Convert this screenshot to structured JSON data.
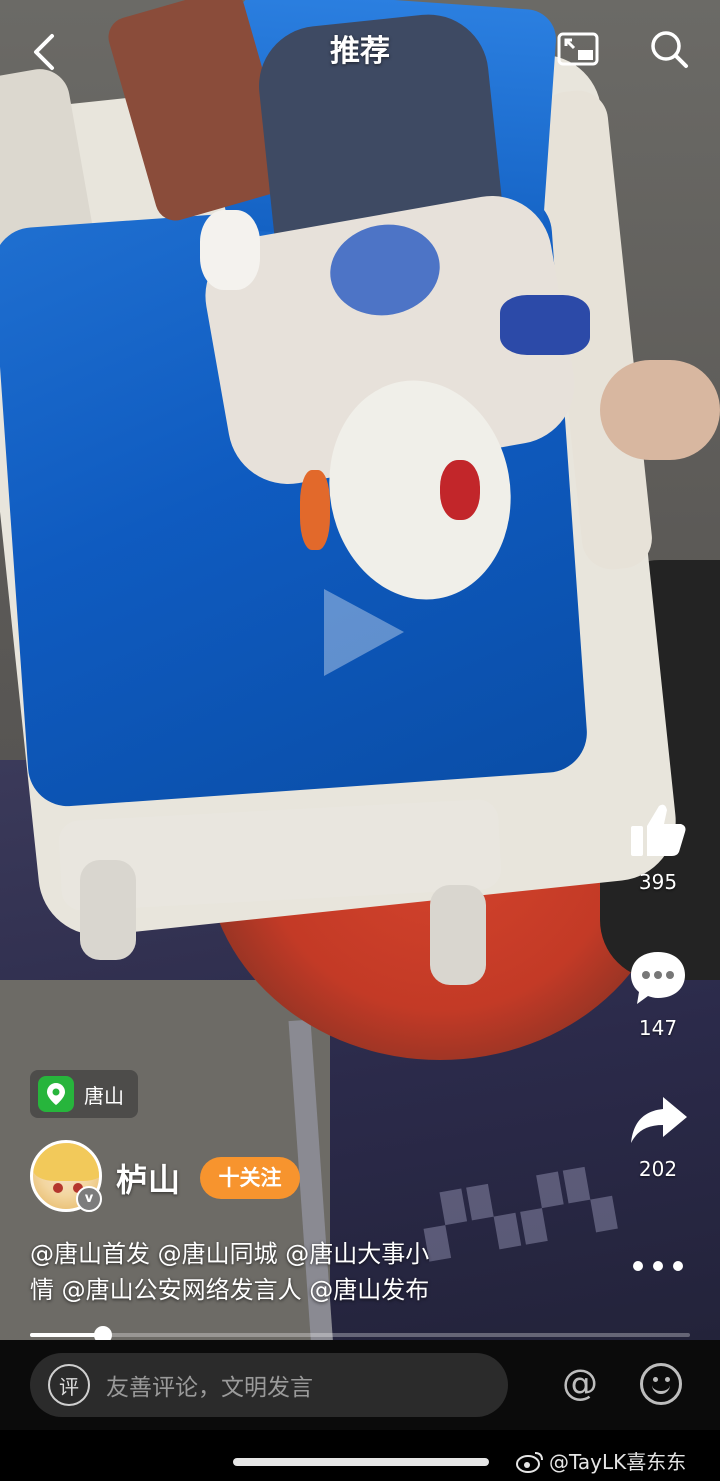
{
  "header": {
    "title": "推荐"
  },
  "actions": {
    "like_count": "395",
    "comment_count": "147",
    "share_count": "202"
  },
  "location": {
    "label": "唐山"
  },
  "author": {
    "name": "栌山",
    "follow_label": "十关注",
    "verified_badge": "v"
  },
  "caption": {
    "line1": "@唐山首发 @唐山同城 @唐山大事小",
    "line2": "情 @唐山公安网络发言人 @唐山发布"
  },
  "progress": {
    "fraction": 0.11
  },
  "comment_bar": {
    "ping_glyph": "评",
    "placeholder": "友善评论，文明发言",
    "at_glyph": "@"
  },
  "watermark": {
    "text": "@TayLK喜东东"
  },
  "colors": {
    "follow_button": "#f7942e",
    "location_pin": "#27b53c"
  },
  "icons": [
    "back-icon",
    "pip-icon",
    "search-icon",
    "play-icon",
    "like-icon",
    "comment-icon",
    "share-icon",
    "more-icon",
    "location-pin-icon",
    "ping-icon",
    "at-icon",
    "emoji-icon",
    "weibo-icon"
  ]
}
